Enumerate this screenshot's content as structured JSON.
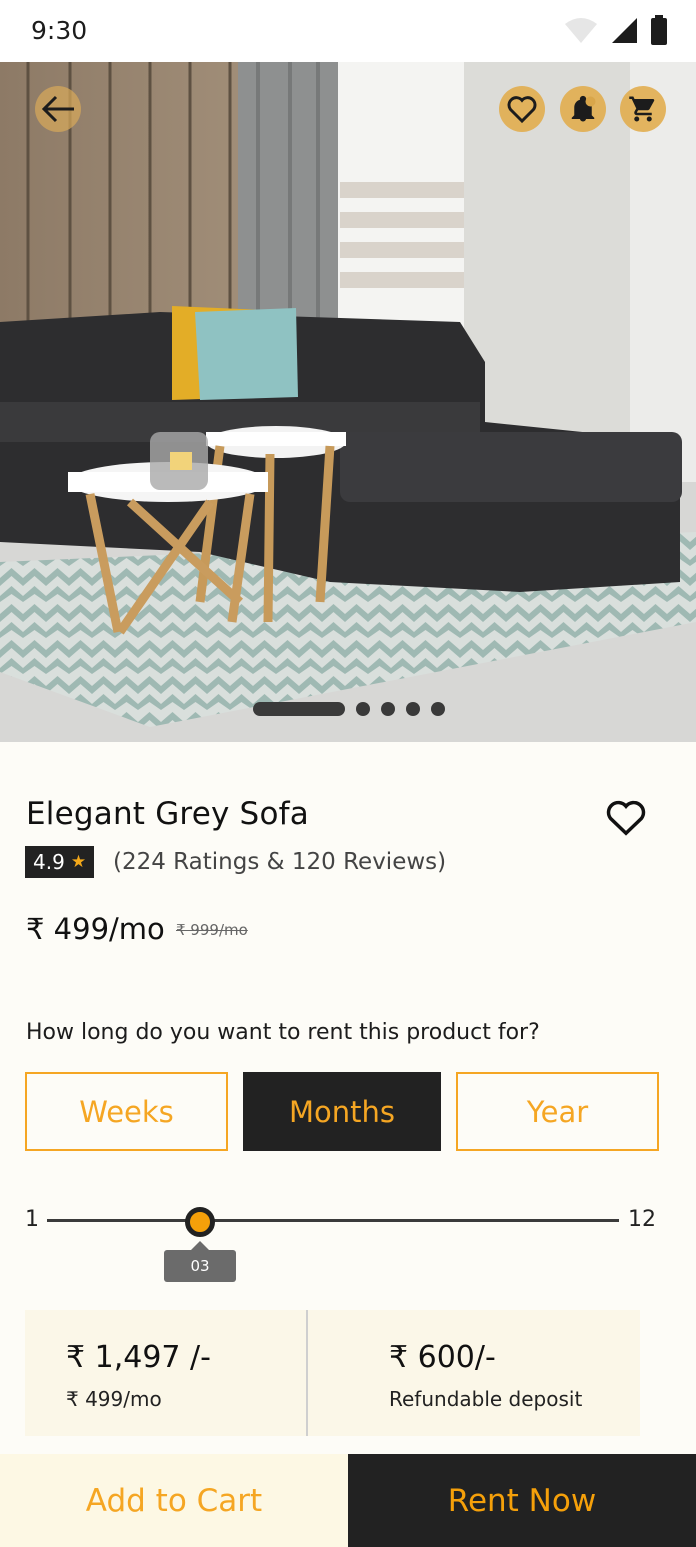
{
  "status_bar": {
    "time": "9:30",
    "icons": [
      "wifi-icon",
      "signal-icon",
      "battery-icon"
    ]
  },
  "hero": {
    "image": "grey-sofa-living-room-photo",
    "icons": [
      "back-arrow-icon",
      "heart-icon",
      "notification-bell-icon",
      "cart-icon"
    ],
    "carousel": {
      "total": 5,
      "active": 1
    }
  },
  "product": {
    "title": "Elegant Grey Sofa",
    "rating": "4.9",
    "rating_star": "★",
    "rating_text": "(224 Ratings & 120 Reviews)",
    "price": "₹ 499/mo",
    "old_price": "₹ 999/mo"
  },
  "rent": {
    "question": "How long do you want to rent this product for?",
    "periods": [
      "Weeks",
      "Months",
      "Year"
    ],
    "selected_period": "Months",
    "slider": {
      "min": "1",
      "max": "12",
      "value_label": "03",
      "value": 3
    }
  },
  "summary": {
    "total": "₹ 1,497 /-",
    "rate": "₹ 499/mo",
    "deposit": "₹ 600/-",
    "deposit_label": "Refundable deposit"
  },
  "actions": {
    "add_to_cart": "Add to Cart",
    "rent_now": "Rent Now"
  },
  "colors": {
    "accent": "#f5a623",
    "dark": "#222222",
    "background": "#fdfcf7"
  }
}
